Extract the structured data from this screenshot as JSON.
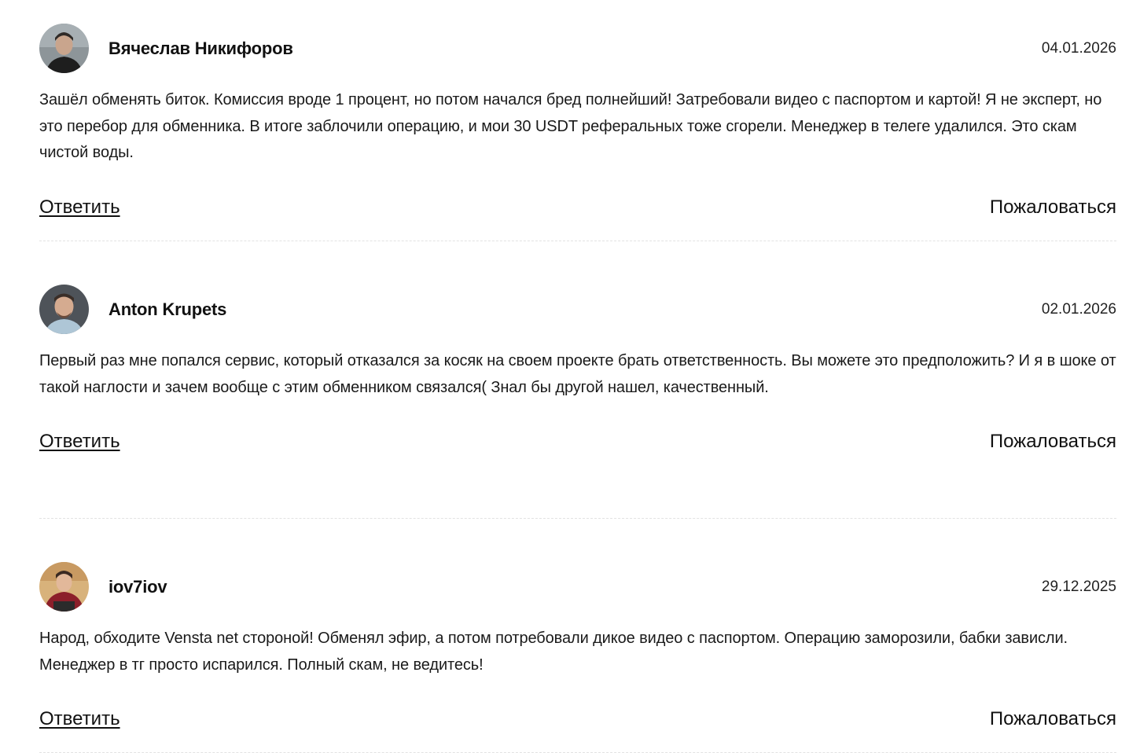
{
  "comments": [
    {
      "author": "Вячеслав Никифоров",
      "date": "04.01.2026",
      "text": "Зашёл обменять биток. Комиссия вроде 1 процент, но потом начался бред полнейший! Затребовали видео с паспортом и картой! Я не эксперт, но это перебор для обменника. В итоге заблочили операцию, и мои 30 USDT реферальных тоже сгорели. Менеджер в телеге удалился. Это скам чистой воды.",
      "reply_label": "Ответить",
      "report_label": "Пожаловаться"
    },
    {
      "author": "Anton Krupets",
      "date": "02.01.2026",
      "text": "Первый раз мне попался сервис, который отказался за косяк на своем проекте брать ответственность. Вы можете это предположить? И я в шоке от такой наглости и зачем вообще с этим обменником связался( Знал бы другой нашел, качественный.",
      "reply_label": "Ответить",
      "report_label": "Пожаловаться"
    },
    {
      "author": "iov7iov",
      "date": "29.12.2025",
      "text": "Народ, обходите Vensta net стороной! Обменял эфир, а потом потребовали дикое видео с паспортом. Операцию заморозили, бабки зависли. Менеджер в тг просто испарился. Полный скам, не ведитесь!",
      "reply_label": "Ответить",
      "report_label": "Пожаловаться"
    }
  ]
}
